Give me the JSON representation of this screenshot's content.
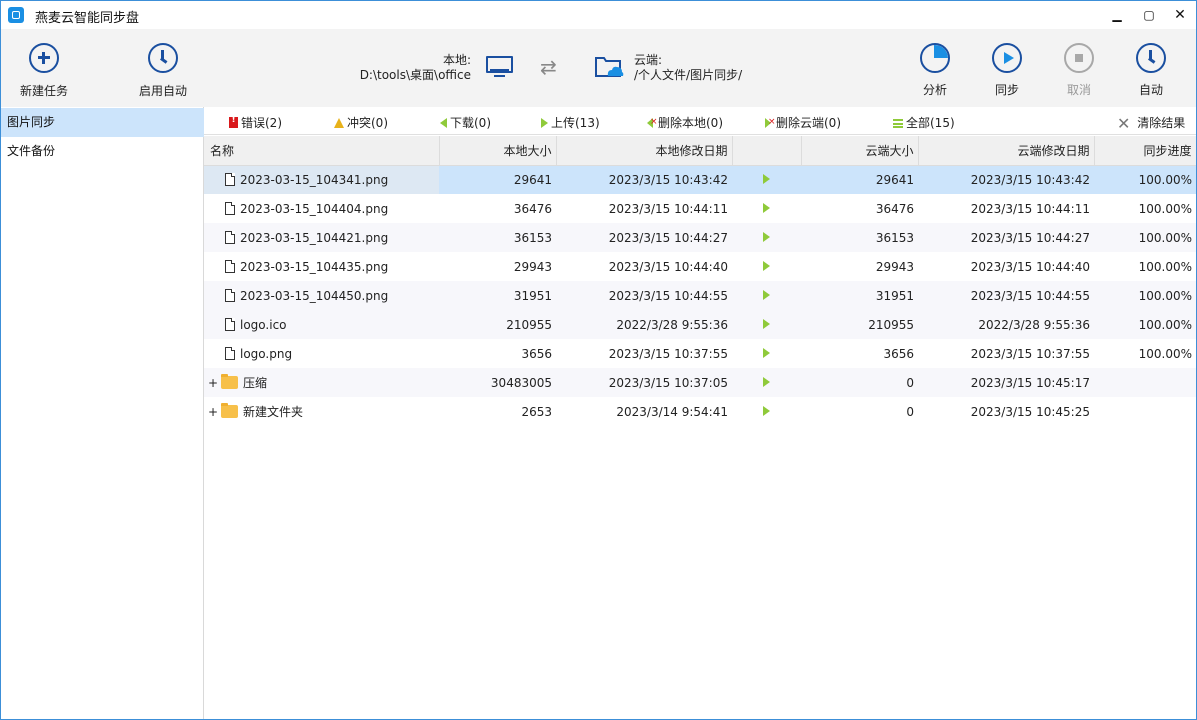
{
  "window": {
    "title": "燕麦云智能同步盘",
    "minimize": "▁",
    "maximize": "▢",
    "close": "✕"
  },
  "sidebar": {
    "new_task": "新建任务",
    "enable_auto": "启用自动",
    "tasks": [
      {
        "label": "图片同步",
        "selected": true
      },
      {
        "label": "文件备份",
        "selected": false
      }
    ]
  },
  "header": {
    "local_label": "本地:",
    "local_path": "D:\\tools\\桌面\\office",
    "cloud_label": "云端:",
    "cloud_path": "/个人文件/图片同步/",
    "swap_glyph": "⇄",
    "analyze": "分析",
    "sync": "同步",
    "cancel": "取消",
    "auto": "自动"
  },
  "filters": {
    "error": "错误(2)",
    "conflict": "冲突(0)",
    "download": "下载(0)",
    "upload": "上传(13)",
    "delete_local": "删除本地(0)",
    "delete_cloud": "删除云端(0)",
    "all": "全部(15)",
    "clear": "清除结果",
    "clear_glyph": "✕"
  },
  "table": {
    "columns": [
      "名称",
      "本地大小",
      "本地修改日期",
      "",
      "云端大小",
      "云端修改日期",
      "同步进度"
    ],
    "rows": [
      {
        "type": "file",
        "name": "2023-03-15_104341.png",
        "local_size": "29641",
        "local_date": "2023/3/15 10:43:42",
        "cloud_size": "29641",
        "cloud_date": "2023/3/15 10:43:42",
        "progress": "100.00%"
      },
      {
        "type": "file",
        "name": "2023-03-15_104404.png",
        "local_size": "36476",
        "local_date": "2023/3/15 10:44:11",
        "cloud_size": "36476",
        "cloud_date": "2023/3/15 10:44:11",
        "progress": "100.00%"
      },
      {
        "type": "file",
        "name": "2023-03-15_104421.png",
        "local_size": "36153",
        "local_date": "2023/3/15 10:44:27",
        "cloud_size": "36153",
        "cloud_date": "2023/3/15 10:44:27",
        "progress": "100.00%"
      },
      {
        "type": "file",
        "name": "2023-03-15_104435.png",
        "local_size": "29943",
        "local_date": "2023/3/15 10:44:40",
        "cloud_size": "29943",
        "cloud_date": "2023/3/15 10:44:40",
        "progress": "100.00%"
      },
      {
        "type": "file",
        "name": "2023-03-15_104450.png",
        "local_size": "31951",
        "local_date": "2023/3/15 10:44:55",
        "cloud_size": "31951",
        "cloud_date": "2023/3/15 10:44:55",
        "progress": "100.00%"
      },
      {
        "type": "file",
        "name": "logo.ico",
        "local_size": "210955",
        "local_date": "2022/3/28 9:55:36",
        "cloud_size": "210955",
        "cloud_date": "2022/3/28 9:55:36",
        "progress": "100.00%"
      },
      {
        "type": "file",
        "name": "logo.png",
        "local_size": "3656",
        "local_date": "2023/3/15 10:37:55",
        "cloud_size": "3656",
        "cloud_date": "2023/3/15 10:37:55",
        "progress": "100.00%"
      },
      {
        "type": "folder",
        "expand": "+",
        "name": "压缩",
        "local_size": "30483005",
        "local_date": "2023/3/15 10:37:05",
        "cloud_size": "0",
        "cloud_date": "2023/3/15 10:45:17",
        "progress": ""
      },
      {
        "type": "folder",
        "expand": "+",
        "name": "新建文件夹",
        "local_size": "2653",
        "local_date": "2023/3/14 9:54:41",
        "cloud_size": "0",
        "cloud_date": "2023/3/15 10:45:25",
        "progress": ""
      }
    ]
  }
}
